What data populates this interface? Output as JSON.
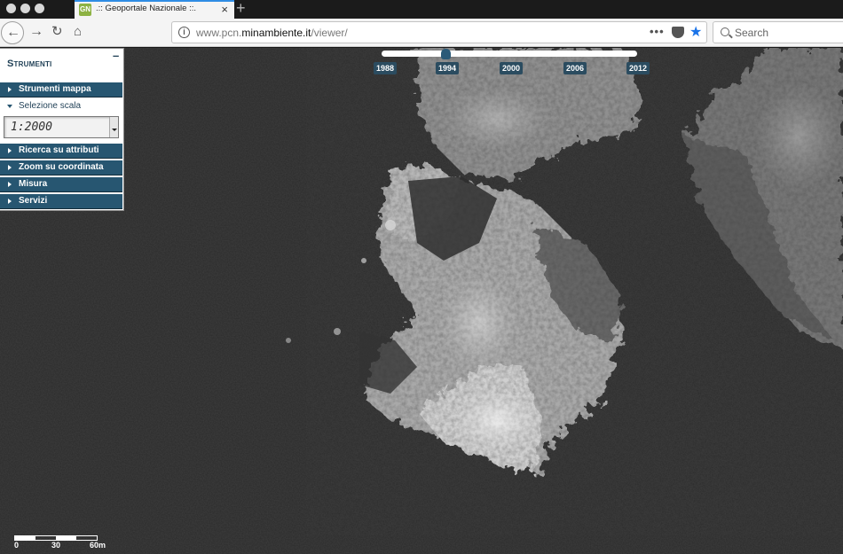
{
  "browser": {
    "tab_title": ".:: Geoportale Nazionale ::.",
    "favicon_text": "GN",
    "url_prefix": "www.pcn.",
    "url_domain": "minambiente.it",
    "url_path": "/viewer/",
    "search_placeholder": "Search",
    "accent_color": "#2f8de4"
  },
  "panel": {
    "title": "Strumenti",
    "items": [
      {
        "label": "Strumenti mappa",
        "state": "collapsed"
      },
      {
        "label": "Selezione scala",
        "state": "expanded"
      },
      {
        "label": "Ricerca su attributi",
        "state": "collapsed"
      },
      {
        "label": "Zoom su coordinata",
        "state": "collapsed"
      },
      {
        "label": "Misura",
        "state": "collapsed"
      },
      {
        "label": "Servizi",
        "state": "collapsed"
      }
    ],
    "scale_value": "1:2000",
    "header_color": "#275671"
  },
  "timeline": {
    "years": [
      "1988",
      "1994",
      "2000",
      "2006",
      "2012"
    ],
    "selected": "1994"
  },
  "scalebar": {
    "labels": [
      "0",
      "30",
      "60m"
    ]
  }
}
